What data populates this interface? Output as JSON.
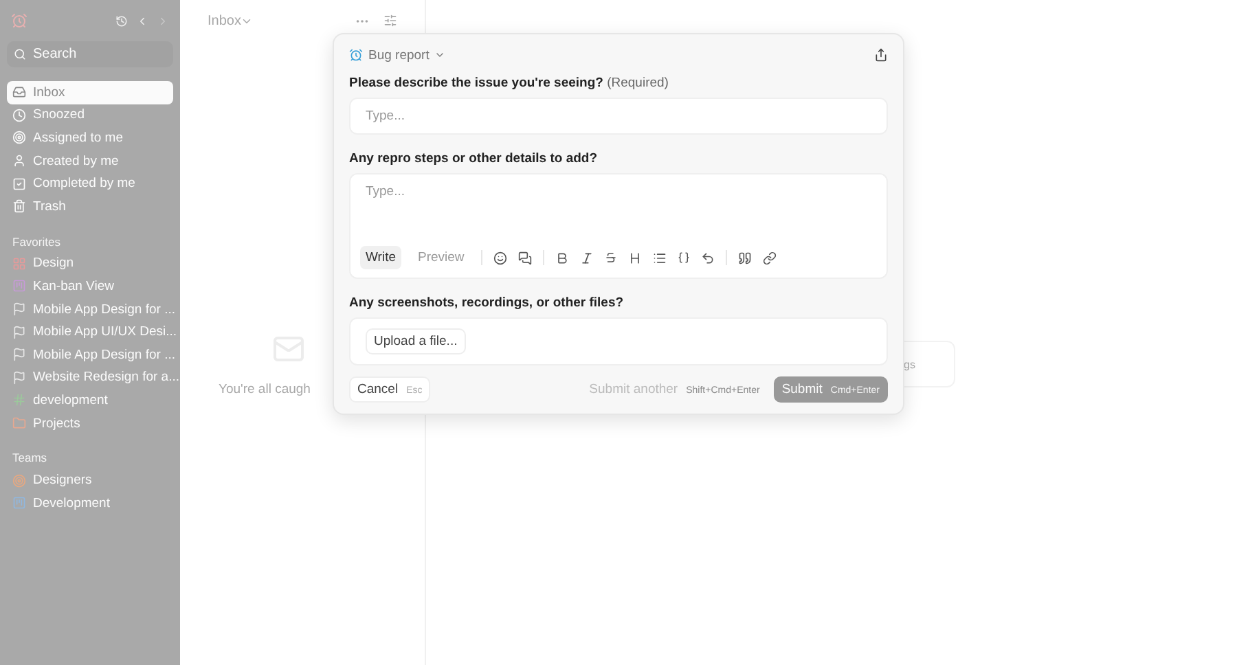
{
  "sidebar": {
    "search": {
      "placeholder": "Search"
    },
    "nav": [
      {
        "label": "Inbox",
        "selected": true
      },
      {
        "label": "Snoozed",
        "selected": false
      },
      {
        "label": "Assigned to me",
        "selected": false
      },
      {
        "label": "Created by me",
        "selected": false
      },
      {
        "label": "Completed by me",
        "selected": false
      },
      {
        "label": "Trash",
        "selected": false
      }
    ],
    "favorites_heading": "Favorites",
    "favorites": [
      {
        "label": "Design",
        "color": "#e89a9a"
      },
      {
        "label": "Kan-ban View",
        "color": "#c79ad8"
      },
      {
        "label": "Mobile App Design for ...",
        "color": "#e8e8e8"
      },
      {
        "label": "Mobile App UI/UX Desi...",
        "color": "#e8e8e8"
      },
      {
        "label": "Mobile App Design for ...",
        "color": "#e8e8e8"
      },
      {
        "label": "Website Redesign for a...",
        "color": "#e8e8e8"
      },
      {
        "label": "development",
        "color": "#9cc89c"
      },
      {
        "label": "Projects",
        "color": "#e8a890"
      }
    ],
    "teams_heading": "Teams",
    "teams": [
      {
        "label": "Designers",
        "color": "#e8a880"
      },
      {
        "label": "Development",
        "color": "#90b8e0"
      }
    ]
  },
  "list": {
    "title": "Inbox",
    "empty_text": "You're all caugh"
  },
  "background_card": {
    "text": "gs"
  },
  "dialog": {
    "template": "Bug report",
    "fields": [
      {
        "kind": "input",
        "label": "Please describe the issue you're seeing?",
        "required_note": "(Required)",
        "placeholder": "Type..."
      },
      {
        "kind": "editor",
        "label": "Any repro steps or other details to add?",
        "placeholder": "Type...",
        "tabs": [
          {
            "label": "Write",
            "selected": true
          },
          {
            "label": "Preview",
            "selected": false
          }
        ]
      },
      {
        "kind": "upload",
        "label": "Any screenshots, recordings, or other files?",
        "button": "Upload a file..."
      }
    ],
    "cancel": {
      "label": "Cancel",
      "shortcut": "Esc"
    },
    "submit_another": {
      "label": "Submit another",
      "shortcut": "Shift+Cmd+Enter"
    },
    "submit": {
      "label": "Submit",
      "shortcut": "Cmd+Enter",
      "disabled": true
    }
  }
}
